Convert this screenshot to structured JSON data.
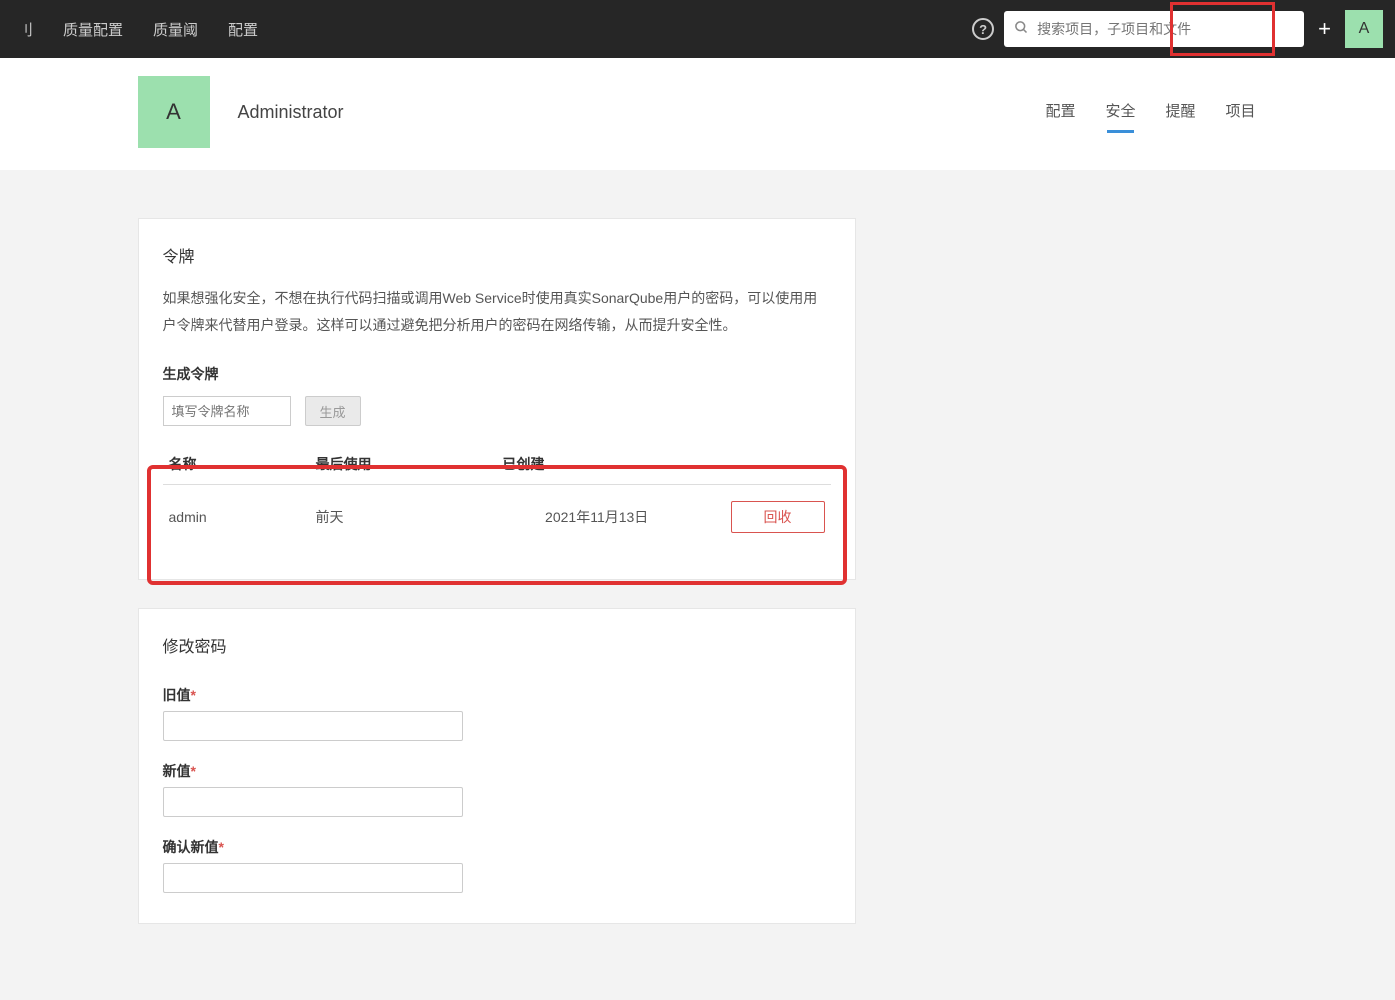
{
  "topbar": {
    "nav": [
      "刂",
      "质量配置",
      "质量阈",
      "配置"
    ],
    "search_placeholder": "搜索项目，子项目和文件",
    "avatar_letter": "A"
  },
  "profile": {
    "avatar_letter": "A",
    "name": "Administrator",
    "tabs": [
      "配置",
      "安全",
      "提醒",
      "项目"
    ],
    "active_tab_index": 1
  },
  "tokens_panel": {
    "title": "令牌",
    "description": "如果想强化安全，不想在执行代码扫描或调用Web Service时使用真实SonarQube用户的密码，可以使用用户令牌来代替用户登录。这样可以通过避免把分析用户的密码在网络传输，从而提升安全性。",
    "generate_label": "生成令牌",
    "token_name_placeholder": "填写令牌名称",
    "generate_button": "生成",
    "columns": {
      "name": "名称",
      "last_used": "最后使用",
      "created": "已创建"
    },
    "rows": [
      {
        "name": "admin",
        "last_used": "前天",
        "created": "2021年11月13日",
        "revoke": "回收"
      }
    ]
  },
  "password_panel": {
    "title": "修改密码",
    "old_label": "旧值",
    "new_label": "新值",
    "confirm_label": "确认新值"
  }
}
